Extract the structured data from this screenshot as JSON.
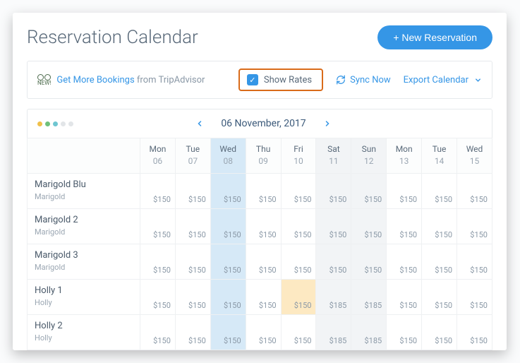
{
  "header": {
    "title": "Reservation Calendar",
    "new_reservation": "+ New Reservation"
  },
  "toolbar": {
    "new_tag": "NEW!",
    "bookings_link": "Get More Bookings",
    "bookings_suffix": " from TripAdvisor",
    "show_rates": "Show Rates",
    "sync_now": "Sync Now",
    "export": "Export Calendar"
  },
  "date_nav": {
    "label": "06 November, 2017"
  },
  "days": [
    {
      "dow": "Mon",
      "num": "06",
      "today": false,
      "weekend": false
    },
    {
      "dow": "Tue",
      "num": "07",
      "today": false,
      "weekend": false
    },
    {
      "dow": "Wed",
      "num": "08",
      "today": true,
      "weekend": false
    },
    {
      "dow": "Thu",
      "num": "09",
      "today": false,
      "weekend": false
    },
    {
      "dow": "Fri",
      "num": "10",
      "today": false,
      "weekend": false
    },
    {
      "dow": "Sat",
      "num": "11",
      "today": false,
      "weekend": true
    },
    {
      "dow": "Sun",
      "num": "12",
      "today": false,
      "weekend": true
    },
    {
      "dow": "Mon",
      "num": "13",
      "today": false,
      "weekend": false
    },
    {
      "dow": "Tue",
      "num": "14",
      "today": false,
      "weekend": false
    },
    {
      "dow": "Wed",
      "num": "15",
      "today": false,
      "weekend": false
    }
  ],
  "rooms": [
    {
      "name": "Marigold Blu",
      "sub": "Marigold",
      "rates": [
        "$150",
        "$150",
        "$150",
        "$150",
        "$150",
        "$150",
        "$150",
        "$150",
        "$150",
        "$150"
      ],
      "highlight": []
    },
    {
      "name": "Marigold 2",
      "sub": "Marigold",
      "rates": [
        "$150",
        "$150",
        "$150",
        "$150",
        "$150",
        "$150",
        "$150",
        "$150",
        "$150",
        "$150"
      ],
      "highlight": []
    },
    {
      "name": "Marigold 3",
      "sub": "Marigold",
      "rates": [
        "$150",
        "$150",
        "$150",
        "$150",
        "$150",
        "$150",
        "$150",
        "$150",
        "$150",
        "$150"
      ],
      "highlight": []
    },
    {
      "name": "Holly 1",
      "sub": "Holly",
      "rates": [
        "$150",
        "$150",
        "$150",
        "$150",
        "$150",
        "$185",
        "$185",
        "$150",
        "$150",
        "$150"
      ],
      "highlight": [
        4
      ]
    },
    {
      "name": "Holly 2",
      "sub": "Holly",
      "rates": [
        "$150",
        "$150",
        "$150",
        "$150",
        "$150",
        "$185",
        "$185",
        "$150",
        "$150",
        "$150"
      ],
      "highlight": []
    }
  ]
}
